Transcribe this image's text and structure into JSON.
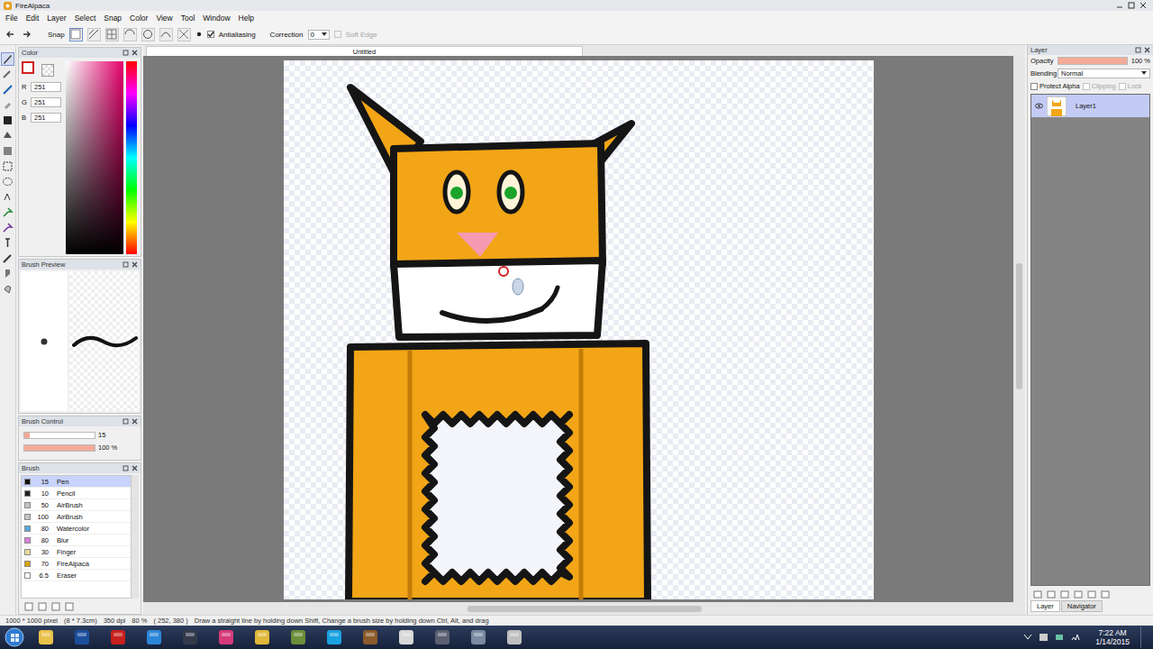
{
  "window": {
    "title": "FireAlpaca"
  },
  "menu": [
    "File",
    "Edit",
    "Layer",
    "Select",
    "Snap",
    "Color",
    "View",
    "Tool",
    "Window",
    "Help"
  ],
  "toolbar": {
    "snap_label": "Snap",
    "snap_modes": [
      {
        "selected": true
      },
      {
        "selected": false
      },
      {
        "selected": false
      },
      {
        "selected": false
      },
      {
        "selected": false
      },
      {
        "selected": false
      },
      {
        "selected": false
      }
    ],
    "antialiasing": {
      "label": "Antialiasing",
      "checked": true
    },
    "correction": {
      "label": "Correction",
      "value": "0"
    },
    "soft_edge": {
      "label": "Soft Edge",
      "checked": false,
      "disabled": true
    }
  },
  "tools": [
    {
      "selected": true
    },
    {
      "selected": false
    },
    {
      "selected": false
    },
    {
      "selected": false
    },
    {
      "selected": false
    },
    {
      "selected": false
    },
    {
      "selected": false
    },
    {
      "selected": false
    },
    {
      "selected": false
    },
    {
      "selected": false
    },
    {
      "selected": false
    },
    {
      "selected": false
    },
    {
      "selected": false
    },
    {
      "selected": false
    },
    {
      "selected": false
    },
    {
      "selected": false
    }
  ],
  "color_panel": {
    "title": "Color",
    "channels": [
      {
        "label": "R",
        "value": "251"
      },
      {
        "label": "G",
        "value": "251"
      },
      {
        "label": "B",
        "value": "251"
      }
    ]
  },
  "brush_preview": {
    "title": "Brush Preview"
  },
  "brush_control": {
    "title": "Brush Control",
    "size": {
      "level": 0.08,
      "reading": "15"
    },
    "opacity": {
      "level": 1,
      "reading": "100 %"
    }
  },
  "brushes": {
    "title": "Brush",
    "items": [
      {
        "size": "15",
        "name": "Pen",
        "selected": true,
        "color": "#111111"
      },
      {
        "size": "10",
        "name": "Pencil",
        "selected": false,
        "color": "#222222"
      },
      {
        "size": "50",
        "name": "AirBrush",
        "selected": false,
        "color": "#c4c4c4"
      },
      {
        "size": "100",
        "name": "AirBrush",
        "selected": false,
        "color": "#c4c4c4"
      },
      {
        "size": "80",
        "name": "Watercolor",
        "selected": false,
        "color": "#5aa8dc"
      },
      {
        "size": "80",
        "name": "Blur",
        "selected": false,
        "color": "#e07fe0"
      },
      {
        "size": "30",
        "name": "Finger",
        "selected": false,
        "color": "#e8d9a0"
      },
      {
        "size": "70",
        "name": "FireAlpaca",
        "selected": false,
        "color": "#d9a400"
      },
      {
        "size": "6.5",
        "name": "Eraser",
        "selected": false,
        "color": "#ffffff"
      }
    ]
  },
  "canvas": {
    "tab": "Untitled"
  },
  "status_bar": {
    "size": "1000 * 1000 pixel",
    "physical": "(8 * 7.3cm)",
    "dpi": "350 dpi",
    "zoom": "80 %",
    "cursor": "( 252, 380 )",
    "hint": "Draw a straight line by holding down Shift, Change a brush size by holding down Ctrl, Alt, and drag"
  },
  "layer_panel": {
    "title": "Layer",
    "opacity": {
      "label": "Opacity",
      "level": 1,
      "reading": "100 %"
    },
    "blending": {
      "label": "Blending",
      "value": "Normal"
    },
    "options": [
      {
        "label": "Protect Alpha",
        "checked": false,
        "disabled": false
      },
      {
        "label": "Clipping",
        "checked": false,
        "disabled": true
      },
      {
        "label": "Lock",
        "checked": false,
        "disabled": true
      }
    ],
    "layers": [
      {
        "name": "Layer1",
        "selected": true,
        "visible": true
      }
    ],
    "tabs": [
      {
        "label": "Layer",
        "selected": true
      },
      {
        "label": "Navigator",
        "selected": false
      }
    ]
  },
  "taskbar": {
    "clock": {
      "time": "7:22 AM",
      "date": "1/14/2015"
    }
  }
}
